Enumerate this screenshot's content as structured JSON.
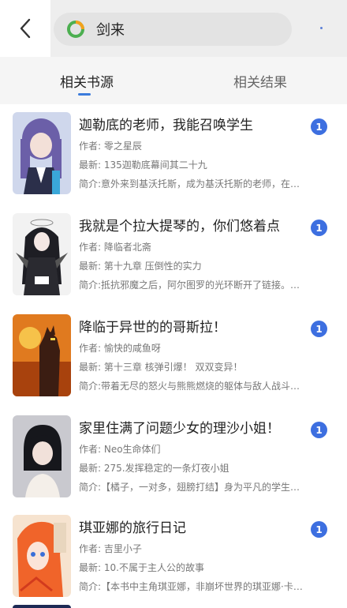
{
  "search": {
    "query": "剑来"
  },
  "tabs": [
    {
      "label": "相关书源"
    },
    {
      "label": "相关结果"
    }
  ],
  "books": [
    {
      "title": "迦勒底的老师，我能召唤学生",
      "author": "作者: 零之星辰",
      "latest": "最新: 135迦勒底幕间其二十九",
      "intro": "简介:意外来到基沃托斯，成为基沃托斯的老师，在…",
      "badge": "1"
    },
    {
      "title": "我就是个拉大提琴的，你们悠着点",
      "author": "作者: 降临者北斋",
      "latest": "最新: 第十九章 压倒性的实力",
      "intro": "简介:抵抗邪魔之后，阿尔图罗的光环断开了链接。…",
      "badge": "1"
    },
    {
      "title": "降临于异世的的哥斯拉！",
      "author": "作者: 愉快的咸鱼呀",
      "latest": "最新: 第十三章 核弹引爆！ 双双变异！",
      "intro": "简介:带着无尽的怒火与熊熊燃烧的躯体与敌人战斗…",
      "badge": "1"
    },
    {
      "title": "家里住满了问题少女的理沙小姐！",
      "author": "作者: Neo生命体们",
      "latest": "最新: 275.发挥稳定的一条灯夜小姐",
      "intro": "简介:【橘子，一对多，翅膀打结】身为平凡的学生…",
      "badge": "1"
    },
    {
      "title": "琪亚娜的旅行日记",
      "author": "作者: 吉里小子",
      "latest": "最新: 10.不属于主人公的故事",
      "intro": "简介:【本书中主角琪亚娜，非崩坏世界的琪亚娜·卡…",
      "badge": "1"
    }
  ],
  "colors": {
    "accent": "#3d6fe0",
    "tab_underline": "#3b7bdc",
    "logo_ring": "#f3a21b",
    "logo_ring2": "#4caf50"
  },
  "icons": {
    "back": "chevron-left-icon",
    "logo": "app-logo-icon"
  }
}
